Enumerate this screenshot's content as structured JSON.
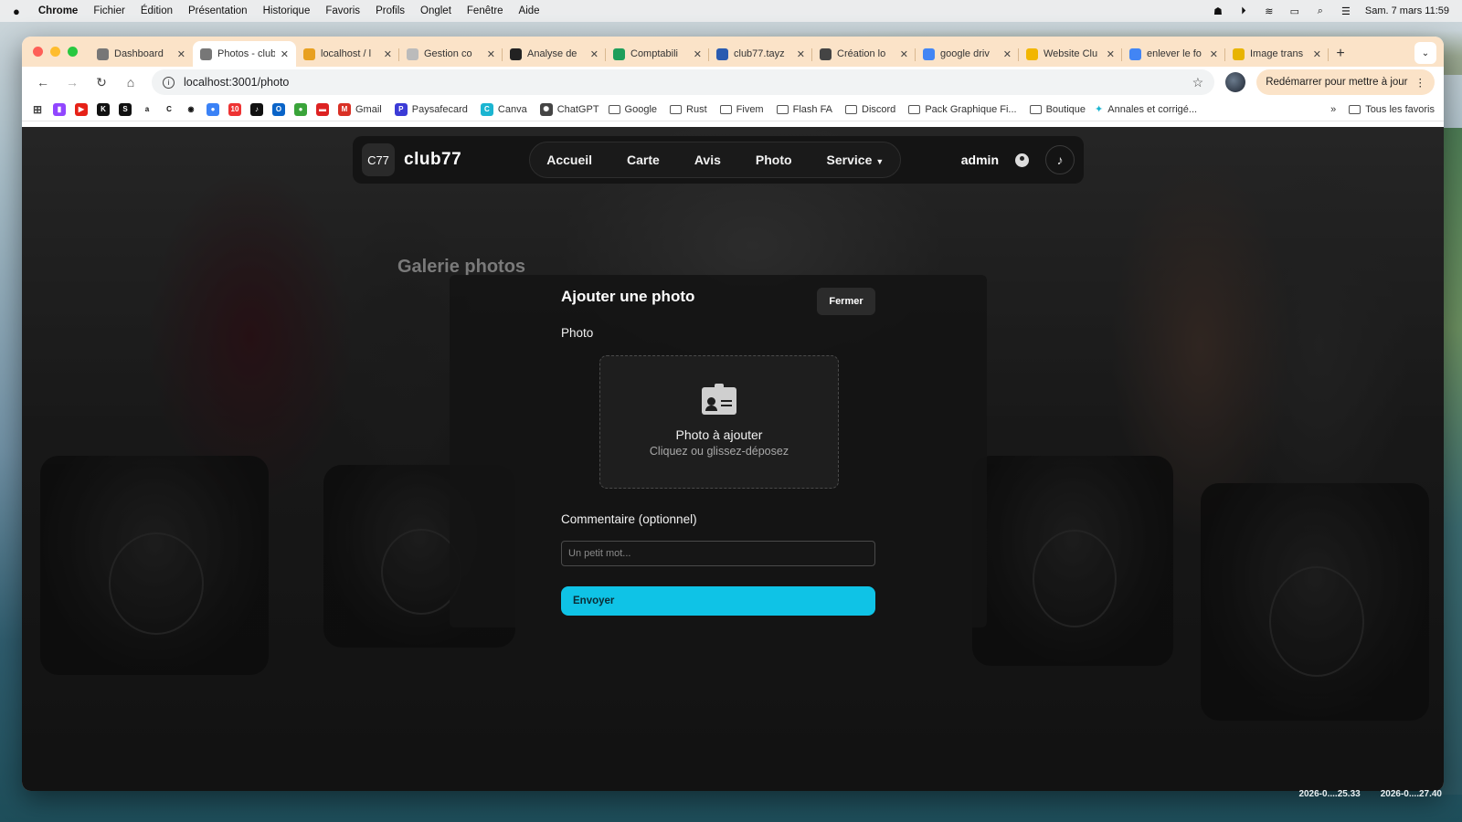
{
  "menubar": {
    "app": "Chrome",
    "items": [
      "Fichier",
      "Édition",
      "Présentation",
      "Historique",
      "Favoris",
      "Profils",
      "Onglet",
      "Fenêtre",
      "Aide"
    ],
    "clock": "Sam. 7 mars  11:59"
  },
  "tabs": [
    {
      "title": "Dashboard",
      "icon": "globe-icon",
      "color": "#777"
    },
    {
      "title": "Photos - club77",
      "icon": "globe-icon",
      "color": "#777"
    },
    {
      "title": "localhost / l",
      "icon": "phpmyadmin-icon",
      "color": "#e8a020"
    },
    {
      "title": "Gestion co",
      "icon": "doc-icon",
      "color": "#bbb"
    },
    {
      "title": "Analyse de",
      "icon": "github-icon",
      "color": "#222"
    },
    {
      "title": "Comptabili",
      "icon": "sheets-icon",
      "color": "#1e9e5a"
    },
    {
      "title": "club77.tayz",
      "icon": "bird-icon",
      "color": "#2a5bb0"
    },
    {
      "title": "Création lo",
      "icon": "openai-icon",
      "color": "#444"
    },
    {
      "title": "google driv",
      "icon": "google-icon",
      "color": "#4285f4"
    },
    {
      "title": "Website Clu",
      "icon": "drive-icon",
      "color": "#f2b600"
    },
    {
      "title": "enlever le fo",
      "icon": "google-icon",
      "color": "#4285f4"
    },
    {
      "title": "Image trans",
      "icon": "image-icon",
      "color": "#e8b400"
    }
  ],
  "address": {
    "url": "localhost:3001/photo"
  },
  "update_button": "Redémarrer pour mettre à jour",
  "bookmarks": {
    "icons": [
      {
        "name": "twitch-icon",
        "color": "#9146ff",
        "glyph": "▮"
      },
      {
        "name": "youtube-icon",
        "color": "#e62117",
        "glyph": "▶"
      },
      {
        "name": "kick-icon",
        "color": "#111",
        "glyph": "K"
      },
      {
        "name": "s-icon",
        "color": "#111",
        "glyph": "S"
      },
      {
        "name": "amazon-icon",
        "color": "#fff",
        "glyph": "a"
      },
      {
        "name": "c-icon",
        "color": "#fff",
        "glyph": "C"
      },
      {
        "name": "circle-icon",
        "color": "#fff",
        "glyph": "◉"
      },
      {
        "name": "blue-app-icon",
        "color": "#3b82f6",
        "glyph": "●"
      },
      {
        "name": "badge-icon",
        "color": "#e33",
        "glyph": "10"
      },
      {
        "name": "tiktok-icon",
        "color": "#111",
        "glyph": "♪"
      },
      {
        "name": "outlook-icon",
        "color": "#0a64c8",
        "glyph": "O"
      },
      {
        "name": "green-app-icon",
        "color": "#3aa43a",
        "glyph": "●"
      },
      {
        "name": "red-app-icon",
        "color": "#d22",
        "glyph": "▬"
      }
    ],
    "items": [
      {
        "label": "Gmail",
        "icon": "gmail-icon",
        "color": "#d93025",
        "glyph": "M"
      },
      {
        "label": "Paysafecard",
        "icon": "paysafecard-icon",
        "color": "#3b3bd6",
        "glyph": "P"
      },
      {
        "label": "Canva",
        "icon": "canva-icon",
        "color": "#1bb5d1",
        "glyph": "C"
      },
      {
        "label": "ChatGPT",
        "icon": "openai-icon",
        "color": "#444",
        "glyph": "✺"
      }
    ],
    "folders": [
      "Google",
      "Rust",
      "Fivem",
      "Flash FA",
      "Discord",
      "Pack Graphique Fi...",
      "Boutique"
    ],
    "extra": "Annales et corrigé...",
    "all": "Tous les favoris"
  },
  "site": {
    "logo": "C77",
    "brand": "club77",
    "nav": [
      "Accueil",
      "Carte",
      "Avis",
      "Photo"
    ],
    "service": "Service",
    "user": "admin"
  },
  "gallery_title": "Galerie photos",
  "modal": {
    "title": "Ajouter une photo",
    "close": "Fermer",
    "photo_label": "Photo",
    "drop_title": "Photo à ajouter",
    "drop_sub": "Cliquez ou glissez-déposez",
    "comment_label": "Commentaire (optionnel)",
    "comment_placeholder": "Un petit mot...",
    "comment_value": "",
    "submit": "Envoyer"
  },
  "desktop_files": [
    "2026-0....25.33",
    "2026-0....27.40"
  ],
  "colors": {
    "accent": "#0fc3e6",
    "tab_strip": "#fbe3c8"
  }
}
